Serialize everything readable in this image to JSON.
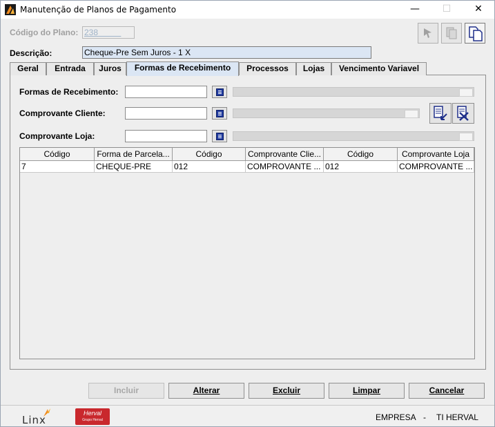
{
  "window": {
    "title": "Manutenção de Planos de Pagamento",
    "minimize": "—",
    "maximize": "☐",
    "close": "✕"
  },
  "form": {
    "codigo_label": "Código do Plano:",
    "codigo_value": "238",
    "descricao_label": "Descrição:",
    "descricao_value": "Cheque-Pre Sem Juros - 1 X"
  },
  "tabs": [
    "Geral",
    "Entrada",
    "Juros",
    "Formas de Recebimento",
    "Processos",
    "Lojas",
    "Vencimento Variavel"
  ],
  "active_tab": "Formas de Recebimento",
  "fields": {
    "formas_label": "Formas de Recebimento:",
    "comprovante_cliente_label": "Comprovante Cliente:",
    "comprovante_loja_label": "Comprovante Loja:"
  },
  "table": {
    "columns": [
      "Código",
      "Forma de Parcela...",
      "Código",
      "Comprovante Clie...",
      "Código",
      "Comprovante Loja"
    ],
    "rows": [
      [
        "7",
        "CHEQUE-PRE",
        "012",
        "COMPROVANTE ...",
        "012",
        "COMPROVANTE ..."
      ]
    ]
  },
  "buttons": {
    "incluir": "Incluir",
    "alterar": "Alterar",
    "excluir": "Excluir",
    "limpar": "Limpar",
    "cancelar": "Cancelar"
  },
  "footer": {
    "linx": "Linx",
    "herval": "Herval",
    "herval_sub": "Grupo Herval",
    "empresa": "EMPRESA",
    "separator": "-",
    "empresa_value": "TI HERVAL"
  },
  "colors": {
    "active_tab": "#dbe6f4",
    "herval_red": "#c9282d",
    "picker_blue": "#1f3a9e"
  }
}
